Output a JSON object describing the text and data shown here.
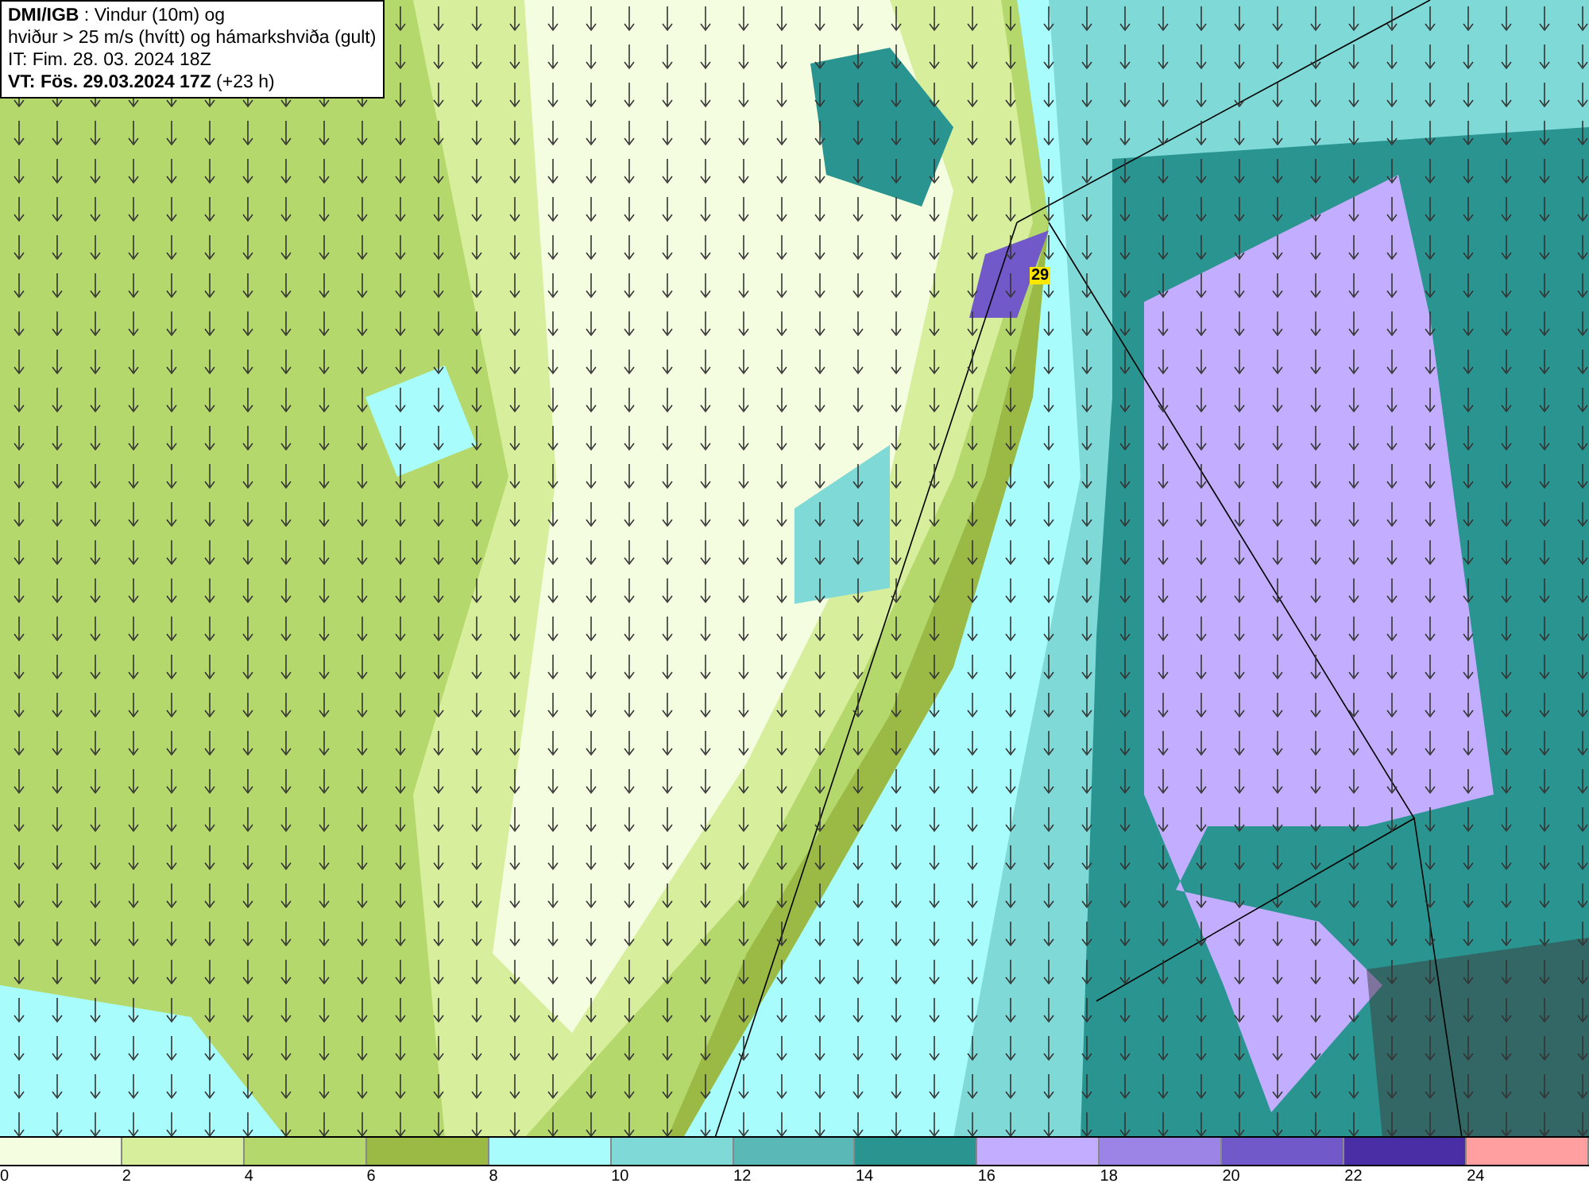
{
  "info": {
    "lines": [
      "**DMI/IGB** : Vindur (10m) og",
      "hviður > 25 m/s (hvítt) og hámarkshviða (gult)",
      "IT: Fim. 28. 03. 2024 18Z",
      "**VT: Fös. 29.03.2024 17Z** (+23 h)"
    ]
  },
  "map": {
    "gust_label": "29"
  },
  "legend": {
    "bins": [
      {
        "color": "#f5fde0"
      },
      {
        "color": "#d7ef9c"
      },
      {
        "color": "#b5d86c"
      },
      {
        "color": "#9aba45"
      },
      {
        "color": "#a8fdfc"
      },
      {
        "color": "#7fd9d7"
      },
      {
        "color": "#5ab8b6"
      },
      {
        "color": "#2a9590"
      },
      {
        "color": "#c3adff"
      },
      {
        "color": "#9b84e6"
      },
      {
        "color": "#7159c9"
      },
      {
        "color": "#4a2ea6"
      },
      {
        "color": "#ff9f9f"
      }
    ],
    "ticks": [
      "0",
      "2",
      "4",
      "6",
      "8",
      "10",
      "12",
      "14",
      "16",
      "18",
      "20",
      "22",
      "24"
    ]
  }
}
